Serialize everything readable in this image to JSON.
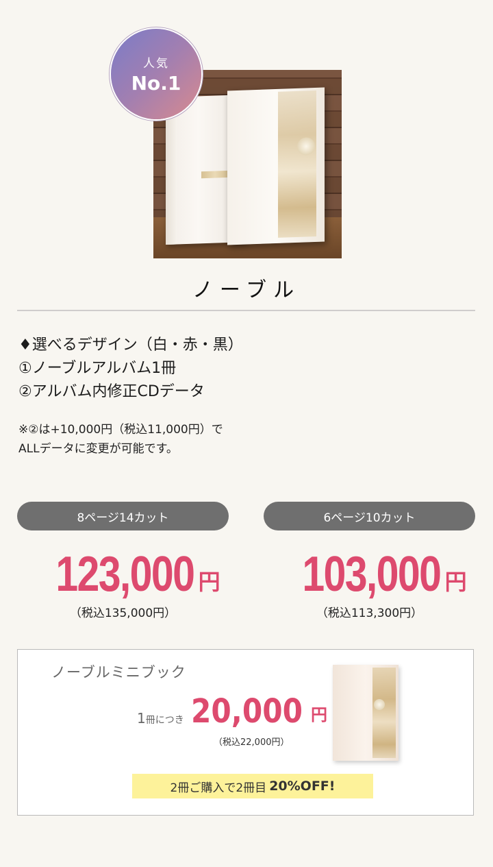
{
  "badge": {
    "small": "人気",
    "big": "No.1"
  },
  "product": {
    "name": "ノーブル"
  },
  "features": [
    "♦選べるデザイン（白・赤・黒）",
    "①ノーブルアルバム1冊",
    "②アルバム内修正CDデータ"
  ],
  "note": [
    "※②は+10,000円（税込11,000円）で",
    "ALLデータに変更が可能です。"
  ],
  "plans": [
    {
      "label": "8ページ14カット",
      "price": "123,000",
      "yen": "円",
      "tax": "（税込135,000円）"
    },
    {
      "label": "6ページ10カット",
      "price": "103,000",
      "yen": "円",
      "tax": "（税込113,300円）"
    }
  ],
  "mini": {
    "title": "ノーブルミニブック",
    "per_num": "1",
    "per_text": "冊につき",
    "price": "20,000",
    "yen": "円",
    "tax": "（税込22,000円）",
    "promo_text": "2冊ご購入で2冊目",
    "promo_highlight": "20%OFF!"
  },
  "colors": {
    "accent": "#dd4a6e",
    "pill": "#6f6f6f",
    "promo_bg": "#fdf29a"
  }
}
